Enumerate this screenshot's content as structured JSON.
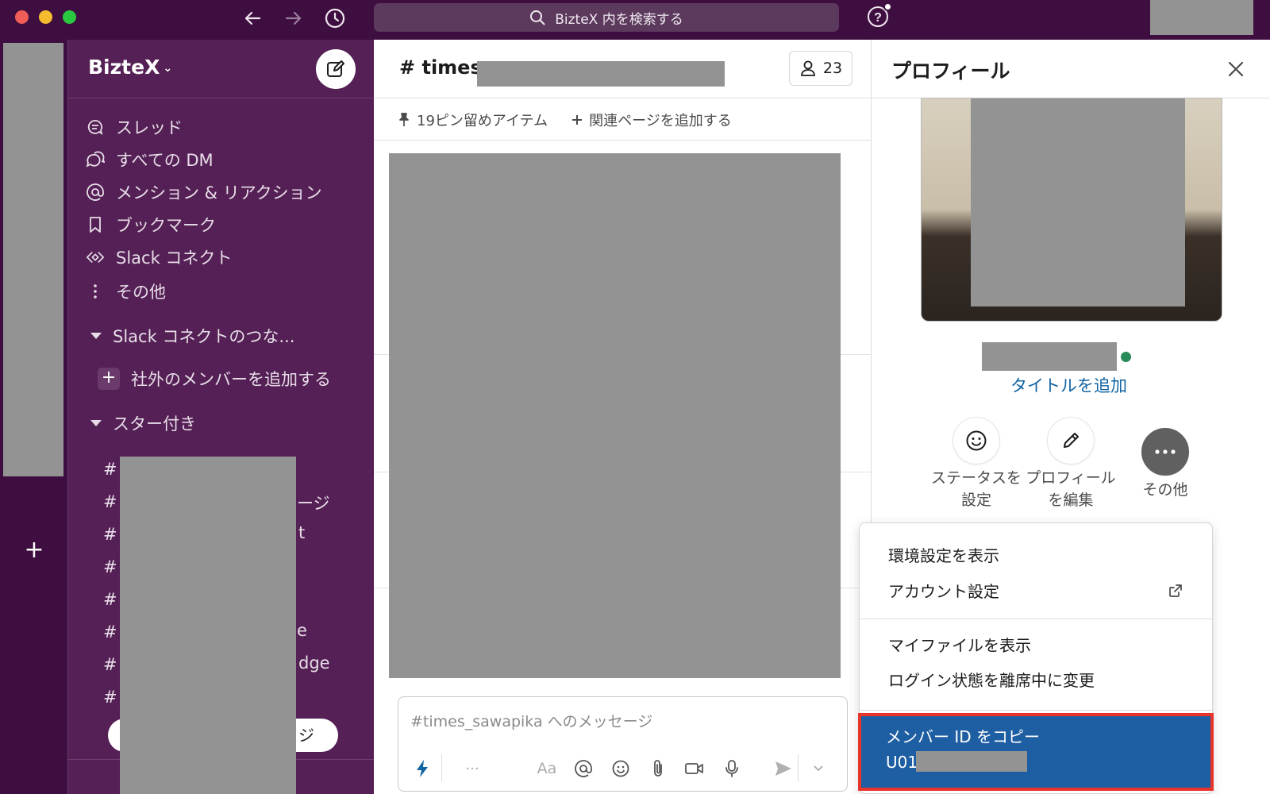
{
  "search": {
    "label": "BizteX 内を検索する"
  },
  "workspace": {
    "name": "BizteX",
    "chevron": "⌄"
  },
  "sidebar": {
    "items": [
      {
        "label": "スレッド",
        "icon": "threads-icon"
      },
      {
        "label": "すべての DM",
        "icon": "dm-icon"
      },
      {
        "label": "メンション & リアクション",
        "icon": "mention-icon"
      },
      {
        "label": "ブックマーク",
        "icon": "bookmark-icon"
      },
      {
        "label": "Slack コネクト",
        "icon": "connect-icon"
      },
      {
        "label": "その他",
        "icon": "more-vertical-icon"
      }
    ],
    "section_connect": "Slack コネクトのつな...",
    "add_external": "社外のメンバーを追加する",
    "section_starred": "スター付き",
    "channel_hash": "#",
    "channel_fragments": [
      "ージ",
      "t",
      "e",
      "dge"
    ],
    "pill_fragment": "ジ"
  },
  "channel": {
    "title": "# times_",
    "member_count": "23",
    "pins": "19ピン留めアイテム",
    "add_page": "関連ページを追加する",
    "composer_placeholder": "#times_sawapika へのメッセージ",
    "format_label": "Aa"
  },
  "profile": {
    "title": "プロフィール",
    "add_title": "タイトルを追加",
    "actions": [
      {
        "label1": "ステータスを",
        "label2": "設定"
      },
      {
        "label1": "プロフィール",
        "label2": "を編集"
      },
      {
        "label1": "その他",
        "label2": ""
      }
    ]
  },
  "menu": {
    "view_preferences": "環境設定を表示",
    "account_settings": "アカウント設定",
    "view_files": "マイファイルを表示",
    "set_away": "ログイン状態を離席中に変更",
    "copy_member_id": "メンバー ID をコピー",
    "member_id_prefix": "U01"
  },
  "colors": {
    "aubergine": "#3f0e40",
    "sidebar": "#542055",
    "link_blue": "#1264a3",
    "highlight_blue": "#1e5ea3",
    "highlight_border": "#e8352a",
    "presence_green": "#2b8a5a"
  }
}
